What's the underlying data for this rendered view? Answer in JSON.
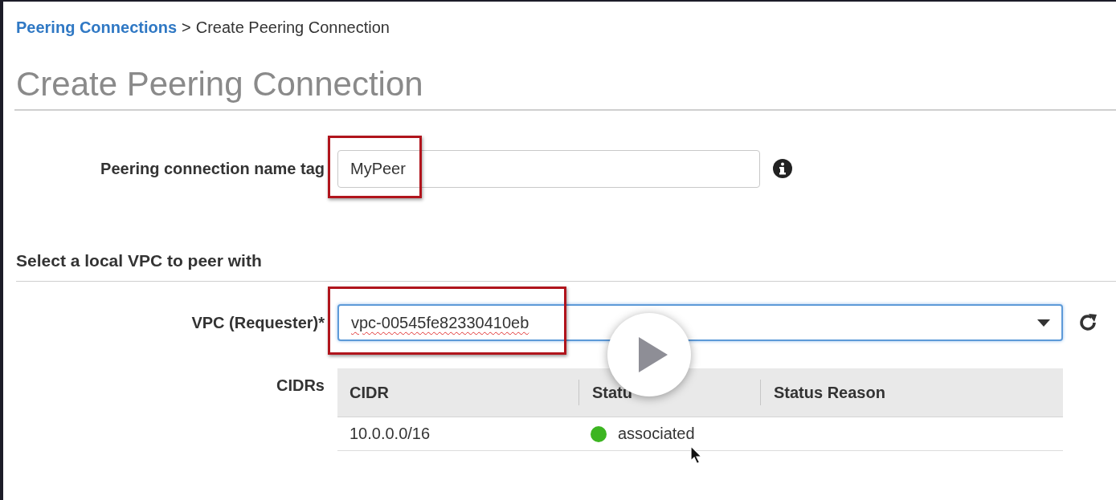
{
  "breadcrumb": {
    "link": "Peering Connections",
    "separator": ">",
    "current": "Create Peering Connection"
  },
  "title": "Create Peering Connection",
  "name_tag": {
    "label": "Peering connection name tag",
    "value": "MyPeer",
    "highlighted": true
  },
  "section": "Select a local VPC to peer with",
  "vpc": {
    "label": "VPC (Requester)*",
    "value": "vpc-00545fe82330410eb",
    "highlighted": true,
    "focused": true
  },
  "cidrs": {
    "label": "CIDRs",
    "columns": [
      "CIDR",
      "Statu",
      "Status Reason"
    ],
    "rows": [
      {
        "cidr": "10.0.0.0/16",
        "status": "associated",
        "color": "#3cb521"
      }
    ]
  }
}
